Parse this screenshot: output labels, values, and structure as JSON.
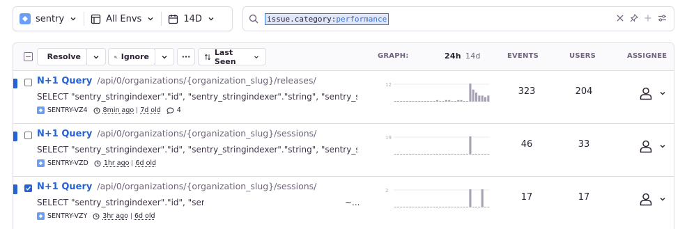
{
  "filters": {
    "project": "sentry",
    "environment": "All Envs",
    "period": "14D"
  },
  "search": {
    "token_key": "issue.category:",
    "token_value": "performance"
  },
  "table_header": {
    "resolve_label": "Resolve",
    "ignore_label": "Ignore",
    "more_label": "···",
    "sort_label": "Last Seen",
    "graph_label": "GRAPH:",
    "graph_24h": "24h",
    "graph_14d": "14d",
    "events_label": "EVENTS",
    "users_label": "USERS",
    "assignee_label": "ASSIGNEE"
  },
  "issues": [
    {
      "title": "N+1 Query",
      "location": "/api/0/organizations/{organization_slug}/releases/",
      "message": "SELECT \"sentry_stringindexer\".\"id\", \"sentry_stringindexer\".\"string\", \"sentry_s...",
      "short_id": "SENTRY-VZ4",
      "last_seen": "8min ago",
      "first_seen": "7d old",
      "comments": "4",
      "graph_max": "12",
      "graph_values": [
        0,
        0,
        0,
        0,
        0,
        0,
        0,
        0,
        0,
        0,
        0,
        0,
        0,
        0,
        1,
        0,
        0,
        1,
        1,
        0,
        0,
        1,
        1,
        0,
        0,
        12,
        8,
        6,
        4,
        4,
        3,
        4
      ],
      "events": "323",
      "users": "204",
      "checked": false
    },
    {
      "title": "N+1 Query",
      "location": "/api/0/organizations/{organization_slug}/sessions/",
      "message": "SELECT \"sentry_stringindexer\".\"id\", \"sentry_stringindexer\".\"string\", \"sentry_s...",
      "short_id": "SENTRY-VZD",
      "last_seen": "1hr ago",
      "first_seen": "6d old",
      "comments": "",
      "graph_max": "19",
      "graph_values": [
        0,
        0,
        0,
        0,
        0,
        0,
        0,
        0,
        0,
        0,
        0,
        0,
        0,
        0,
        0,
        0,
        0,
        0,
        0,
        0,
        0,
        0,
        0,
        0,
        0,
        19,
        0,
        0,
        0,
        0,
        0,
        0
      ],
      "events": "46",
      "users": "33",
      "checked": false
    },
    {
      "title": "N+1 Query",
      "location": "/api/0/organizations/{organization_slug}/sessions/",
      "message": "SELECT \"sentry_stringindexer\".\"id\", \"sen",
      "message_tail": "~...",
      "short_id": "SENTRY-VZY",
      "last_seen": "3hr ago",
      "first_seen": "6d old",
      "comments": "",
      "graph_max": "2",
      "graph_values": [
        0,
        0,
        0,
        0,
        0,
        0,
        0,
        0,
        0,
        0,
        0,
        0,
        0,
        0,
        0,
        0,
        0,
        0,
        0,
        0,
        0,
        0,
        0,
        0,
        0,
        1,
        0,
        0,
        0,
        1,
        0,
        0
      ],
      "events": "17",
      "users": "17",
      "checked": true
    }
  ],
  "colors": {
    "accent": "#2562d4",
    "unread": "#2562d4",
    "graph_bar": "#a8a1b4",
    "border": "#e0dce5"
  }
}
